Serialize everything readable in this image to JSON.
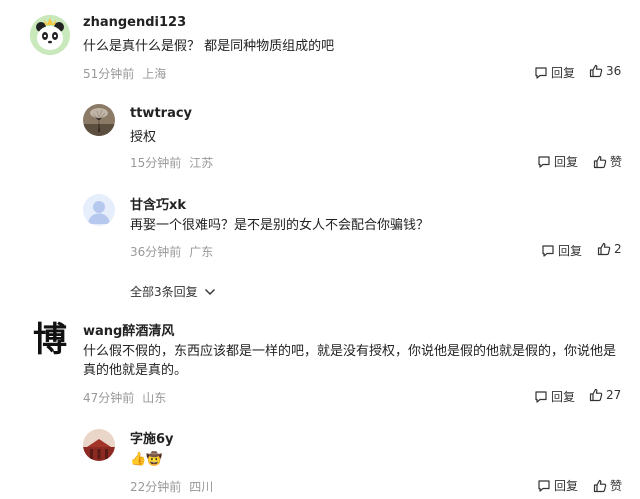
{
  "comments": [
    {
      "username": "zhangendi123",
      "text": "什么是真什么是假？ 都是同种物质组成的吧",
      "time": "51分钟前",
      "location": "上海",
      "reply_label": "回复",
      "like_count": "36",
      "avatar_icon": "panda-avatar",
      "replies": [
        {
          "username": "ttwtracy",
          "text": "授权",
          "time": "15分钟前",
          "location": "江苏",
          "reply_label": "回复",
          "like_label": "赞",
          "avatar_icon": "tree-photo-avatar"
        },
        {
          "username": "甘含巧xk",
          "text": "再娶一个很难吗？是不是别的女人不会配合你骗钱？",
          "time": "36分钟前",
          "location": "广东",
          "reply_label": "回复",
          "like_label": "2",
          "avatar_icon": "default-user-avatar"
        }
      ],
      "expand_label": "全部3条回复"
    },
    {
      "username": "wang醉酒清风",
      "text": "什么假不假的，东西应该都是一样的吧，就是没有授权，你说他是假的他就是假的，你说他是真的他就是真的。",
      "time": "47分钟前",
      "location": "山东",
      "reply_label": "回复",
      "like_count": "27",
      "avatar_icon": "calligraphy-bo-avatar",
      "avatar_text": "博",
      "replies": [
        {
          "username": "字施6y",
          "text": "👍🤠",
          "time": "22分钟前",
          "location": "四川",
          "reply_label": "回复",
          "like_label": "赞",
          "avatar_icon": "temple-photo-avatar"
        }
      ]
    }
  ],
  "colors": {
    "meta": "#999999",
    "text": "#222222"
  }
}
